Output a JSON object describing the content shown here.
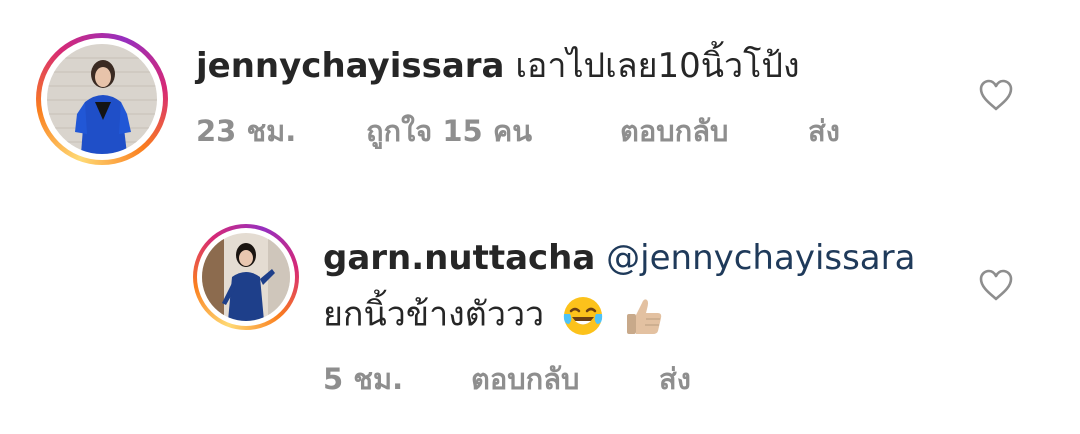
{
  "comments": [
    {
      "username": "jennychayissara",
      "text": "เอาไปเลย10นิ้วโป้ง",
      "time": "23 ชม.",
      "likes": "ถูกใจ 15 คน",
      "reply": "ตอบกลับ",
      "send": "ส่ง"
    }
  ],
  "reply": {
    "username": "garn.nuttacha",
    "mention": "@jennychayissara",
    "text": "ยกนิ้วข้างตัววว",
    "emoji": [
      "face-with-tears-of-joy",
      "thumbs-up-medium-light-skin-tone"
    ],
    "time": "5 ชม.",
    "reply_label": "ตอบกลับ",
    "send": "ส่ง"
  },
  "colors": {
    "text": "#262626",
    "meta": "#8e8e8e",
    "mention": "#1f3a5a",
    "heart_stroke": "#8e8e8e"
  },
  "icons": {
    "like": "heart-outline-icon"
  }
}
